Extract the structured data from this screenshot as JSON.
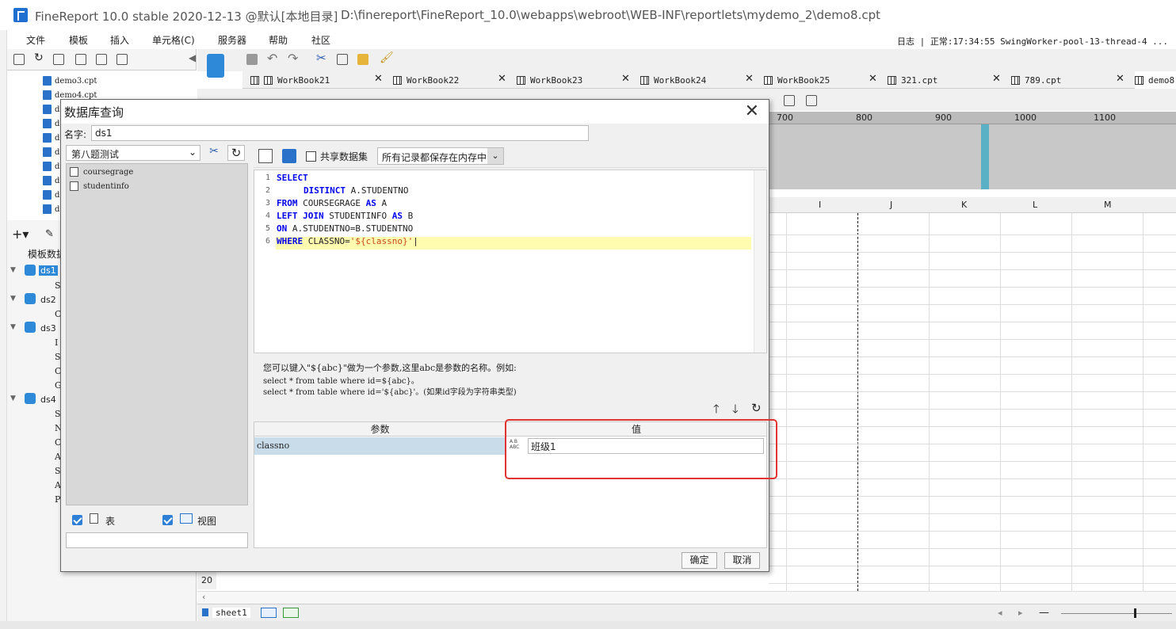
{
  "window": {
    "title": "FineReport 10.0 stable 2020-12-13 @默认[本地目录]",
    "path": "D:\\finereport\\FineReport_10.0\\webapps\\webroot\\WEB-INF\\reportlets\\mydemo_2\\demo8.cpt"
  },
  "menu": [
    "文件",
    "模板",
    "插入",
    "单元格(C)",
    "服务器",
    "帮助",
    "社区"
  ],
  "status": "日志 | 正常:17:34:55 SwingWorker-pool-13-thread-4 ...",
  "file_tree": [
    "demo3.cpt",
    "demo4.cpt",
    "d",
    "d",
    "d",
    "d",
    "d",
    "d",
    "d",
    "d"
  ],
  "left_panel": {
    "section_label": "模板数据",
    "datasets": [
      {
        "name": "ds1",
        "fields": [
          "S"
        ]
      },
      {
        "name": "ds2",
        "fields": [
          "C"
        ]
      },
      {
        "name": "ds3",
        "fields": [
          "I",
          "S",
          "C",
          "G"
        ]
      },
      {
        "name": "ds4",
        "fields": [
          "S",
          "N",
          "C",
          "A",
          "S",
          "A",
          "P"
        ]
      }
    ]
  },
  "tabs": [
    "WorkBook21",
    "WorkBook22",
    "WorkBook23",
    "WorkBook24",
    "WorkBook25",
    "321.cpt",
    "789.cpt",
    "demo8."
  ],
  "ruler": [
    "700",
    "800",
    "900",
    "1000",
    "1100"
  ],
  "columns": [
    "I",
    "J",
    "K",
    "L",
    "M"
  ],
  "row_label": "20",
  "sheet": {
    "name": "sheet1"
  },
  "dialog": {
    "title": "数据库查询",
    "name_label": "名字:",
    "name_value": "ds1",
    "connection": "第八题测试",
    "tables": [
      "coursegrage",
      "studentinfo"
    ],
    "share_label": "共享数据集",
    "memory_option": "所有记录都保存在内存中",
    "sql_lines": [
      {
        "n": "1",
        "kw": "SELECT",
        "rest": ""
      },
      {
        "n": "2",
        "kw": "DISTINCT",
        "rest": " A.STUDENTNO"
      },
      {
        "n": "3",
        "kw": "FROM",
        "rest": " COURSEGRAGE "
      },
      {
        "n": "4",
        "kw": "LEFT JOIN",
        "rest": " STUDENTINFO "
      },
      {
        "n": "5",
        "kw": "ON",
        "rest": " A.STUDENTNO=B.STUDENTNO"
      },
      {
        "n": "6",
        "kw": "WHERE",
        "rest": " CLASSNO="
      }
    ],
    "sql_extra": {
      "as1": "AS",
      "a": " A",
      "as2": "AS",
      "b": " B",
      "param": "'${classno}'"
    },
    "hint": {
      "line1": "您可以键入\"${abc}\"做为一个参数,这里abc是参数的名称。例如:",
      "line2": "select * from table where id=${abc}。",
      "line3": "select * from table where id='${abc}'。(如果id字段为字符串类型)"
    },
    "param_header": {
      "param": "参数",
      "value": "值"
    },
    "params": [
      {
        "name": "classno",
        "value": "班级1"
      }
    ],
    "type_badge": "A.B ABC",
    "table_label": "表",
    "view_label": "视图",
    "ok": "确定",
    "cancel": "取消"
  }
}
